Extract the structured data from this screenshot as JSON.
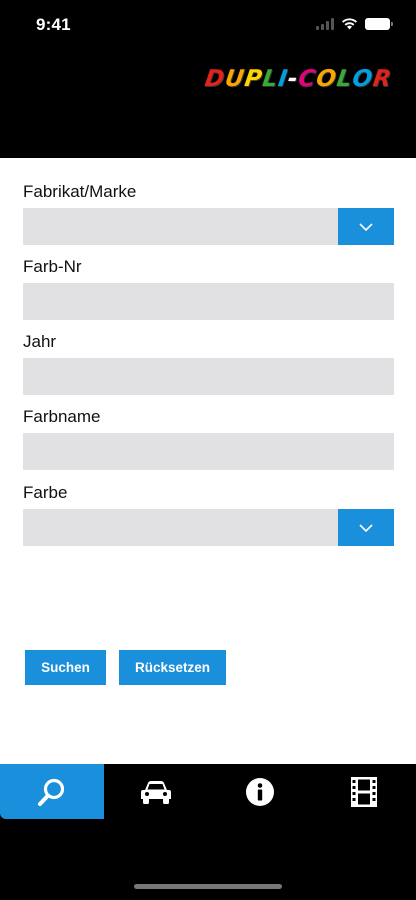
{
  "status_bar": {
    "time": "9:41"
  },
  "brand": {
    "logo_text": "DUPLI-COLOR",
    "logo_colors": [
      "#e2231a",
      "#f6a800",
      "#ffd400",
      "#3aa935",
      "#00a0e3",
      "#ffffff",
      "#e5007e",
      "#f6a800",
      "#3aa935",
      "#00a0e3",
      "#e2231a"
    ]
  },
  "form": {
    "brand_label": "Fabrikat/Marke",
    "brand_value": "",
    "color_number_label": "Farb-Nr",
    "color_number_value": "",
    "year_label": "Jahr",
    "year_value": "",
    "color_name_label": "Farbname",
    "color_name_value": "",
    "color_label": "Farbe",
    "color_value": ""
  },
  "actions": {
    "search_label": "Suchen",
    "reset_label": "Rücksetzen"
  },
  "tabbar": {
    "tabs": [
      {
        "icon": "search-icon",
        "active": true
      },
      {
        "icon": "car-icon",
        "active": false
      },
      {
        "icon": "info-icon",
        "active": false
      },
      {
        "icon": "film-icon",
        "active": false
      }
    ]
  },
  "colors": {
    "accent": "#1a8fdc",
    "field_bg": "#e1e1e3"
  }
}
